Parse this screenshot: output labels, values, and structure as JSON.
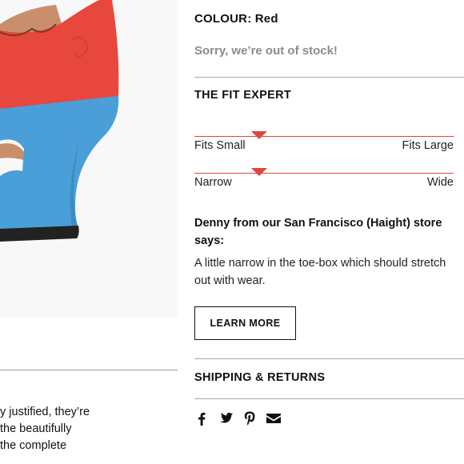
{
  "product": {
    "colour_label": "COLOUR: Red",
    "stock_message": "Sorry, we’re out of stock!"
  },
  "fit_expert": {
    "title": "THE FIT EXPERT",
    "scales": [
      {
        "left_label": "Fits Small",
        "right_label": "Fits Large",
        "marker_position": 0.25
      },
      {
        "left_label": "Narrow",
        "right_label": "Wide",
        "marker_position": 0.25
      }
    ],
    "staff_heading": "Denny from our San Francisco (Haight) store says:",
    "staff_review": "A little narrow in the toe-box which should stretch out with wear.",
    "learn_more_label": "LEARN MORE"
  },
  "shipping": {
    "title": "SHIPPING & RETURNS"
  },
  "description": {
    "lines": [
      "y justified, they’re",
      "the beautifully",
      "the complete"
    ]
  },
  "share": {
    "icons": [
      "facebook-icon",
      "twitter-icon",
      "pinterest-icon",
      "email-icon"
    ]
  },
  "colors": {
    "accent_red": "#e0463f",
    "muted_text": "#8c8c8c",
    "shoe_upper": "#e8473d",
    "shoe_heel": "#4a9fd8"
  }
}
